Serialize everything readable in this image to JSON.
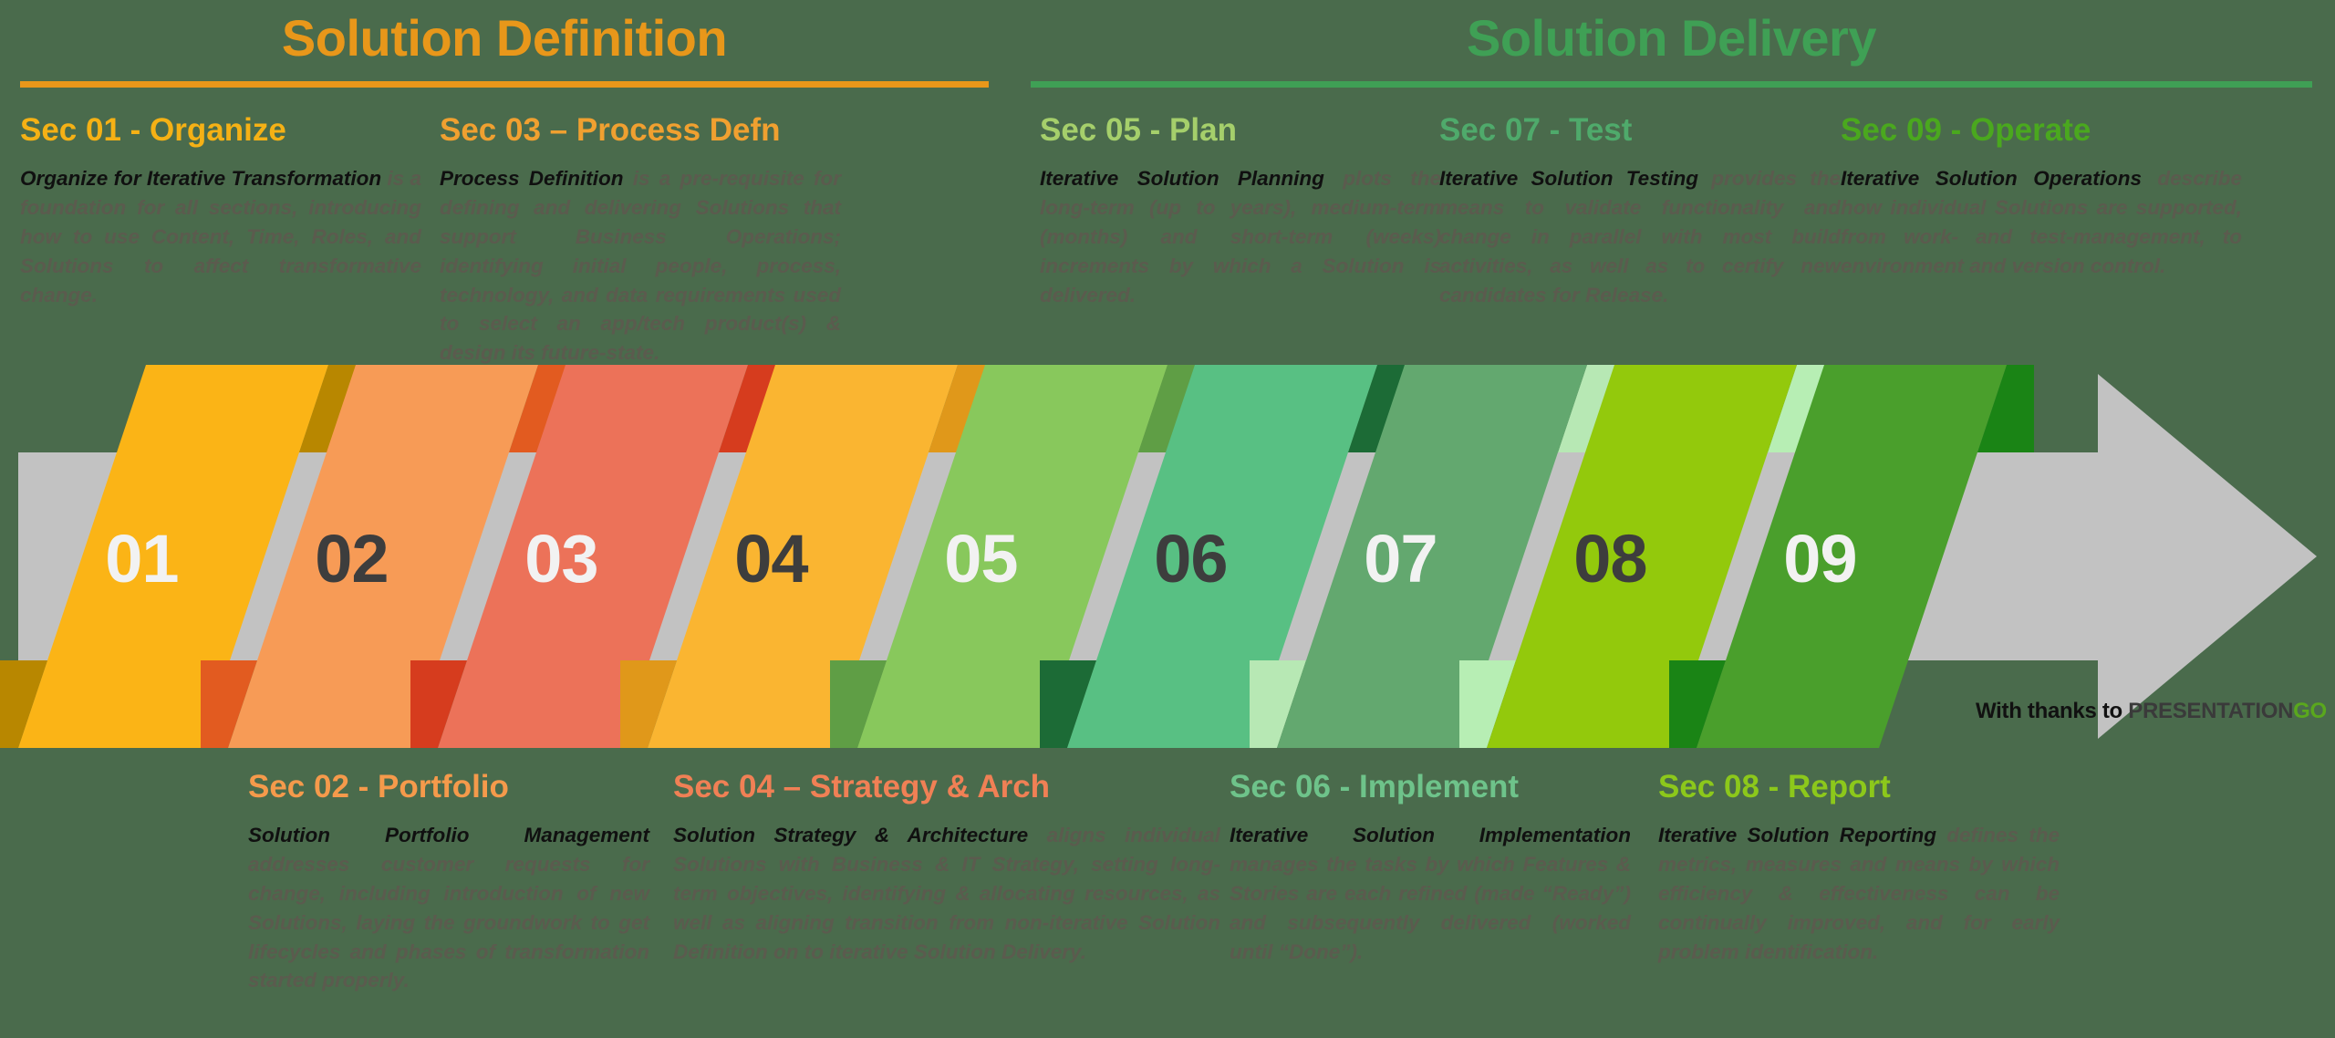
{
  "phases": [
    {
      "id": "definition",
      "title": "Solution Definition",
      "color": "#e8971a"
    },
    {
      "id": "delivery",
      "title": "Solution Delivery",
      "color": "#3fa055"
    }
  ],
  "sections": [
    {
      "number": "01",
      "title": "Sec 01 - Organize",
      "title_color": "#f5b115",
      "lead": "Organize for Iterative Transformation",
      "body": " is a foundation for all sections, introducing how to use Content, Time, Roles, and Solutions to affect transformative change.",
      "chevron_color": "#fbb416",
      "chevron_shadow": "#b88700",
      "number_color": "#f2f2f2"
    },
    {
      "number": "02",
      "title": "Sec 02 - Portfolio",
      "title_color": "#f59a4b",
      "lead": "Solution Portfolio Management",
      "body": " addresses customer requests for change, including introduction of new Solutions, laying the groundwork to get lifecycles and phases of transformation started properly.",
      "chevron_color": "#f79b56",
      "chevron_shadow": "#e25b20",
      "number_color": "#3d3d3d"
    },
    {
      "number": "03",
      "title": "Sec 03 – Process Defn",
      "title_color": "#f0a030",
      "lead": "Process Definition",
      "body": " is a pre-requisite for defining and delivering Solutions that support Business Operations; identifying initial people, process, technology, and data requirements used to select an app/tech product(s) & design its future-state.",
      "chevron_color": "#ec7259",
      "chevron_shadow": "#d63c1e",
      "number_color": "#f2f2f2"
    },
    {
      "number": "04",
      "title": "Sec 04 – Strategy & Arch",
      "title_color": "#f08055",
      "lead": "Solution Strategy & Architecture",
      "body": " aligns individual Solutions with Business & IT Strategy, setting long-term objectives, identifying & allocating resources, as well as aligning transition from non-iterative Solution Definition on to iterative Solution Delivery.",
      "chevron_color": "#fab531",
      "chevron_shadow": "#e0981a",
      "number_color": "#3d3d3d"
    },
    {
      "number": "05",
      "title": "Sec 05 - Plan",
      "title_color": "#a5cf6b",
      "lead": "Iterative Solution Planning",
      "body": " plots the long-term (up to years), medium-term (months) and short-term (weeks) increments by which a Solution is delivered.",
      "chevron_color": "#88c85c",
      "chevron_shadow": "#5f9e45",
      "number_color": "#f2f2f2"
    },
    {
      "number": "06",
      "title": "Sec 06 - Implement",
      "title_color": "#6ec38a",
      "lead": "Iterative Solution Implementation",
      "body": " manages the tasks by which Features & Stories are each refined (made “Ready”) and subsequently delivered (worked until “Done”).",
      "chevron_color": "#58c083",
      "chevron_shadow": "#1c6b36",
      "number_color": "#3d3d3d"
    },
    {
      "number": "07",
      "title": "Sec 07 - Test",
      "title_color": "#4faa6b",
      "lead": "Iterative Solution Testing",
      "body": " provides the means to validate functionality and change in parallel with most build activities, as well as to certify new candidates for Release.",
      "chevron_color": "#63a86f",
      "chevron_shadow": "#b7e8b4",
      "number_color": "#f2f2f2"
    },
    {
      "number": "08",
      "title": "Sec 08 - Report",
      "title_color": "#8cc81b",
      "lead": "Iterative Solution Reporting",
      "body": " defines the metrics, measures and means by which efficiency & effectiveness can be continually improved, and for early problem identification.",
      "chevron_color": "#93c90c",
      "chevron_shadow": "#b7eeb4",
      "number_color": "#3d3d3d"
    },
    {
      "number": "09",
      "title": "Sec 09 - Operate",
      "title_color": "#4aa81e",
      "lead": "Iterative Solution Operations",
      "body": " describe how individual Solutions are supported, from work- and test-management, to environment and version control.",
      "chevron_color": "#4a9f2c",
      "chevron_shadow": "#1a8415",
      "number_color": "#f2f2f2"
    }
  ],
  "arrow": {
    "band_color": "#c2c2c2",
    "background_color": "#4a6b4c"
  },
  "attribution": {
    "prefix": "With thanks to ",
    "brand": "PRESENTATION",
    "brand_suffix": "GO"
  }
}
